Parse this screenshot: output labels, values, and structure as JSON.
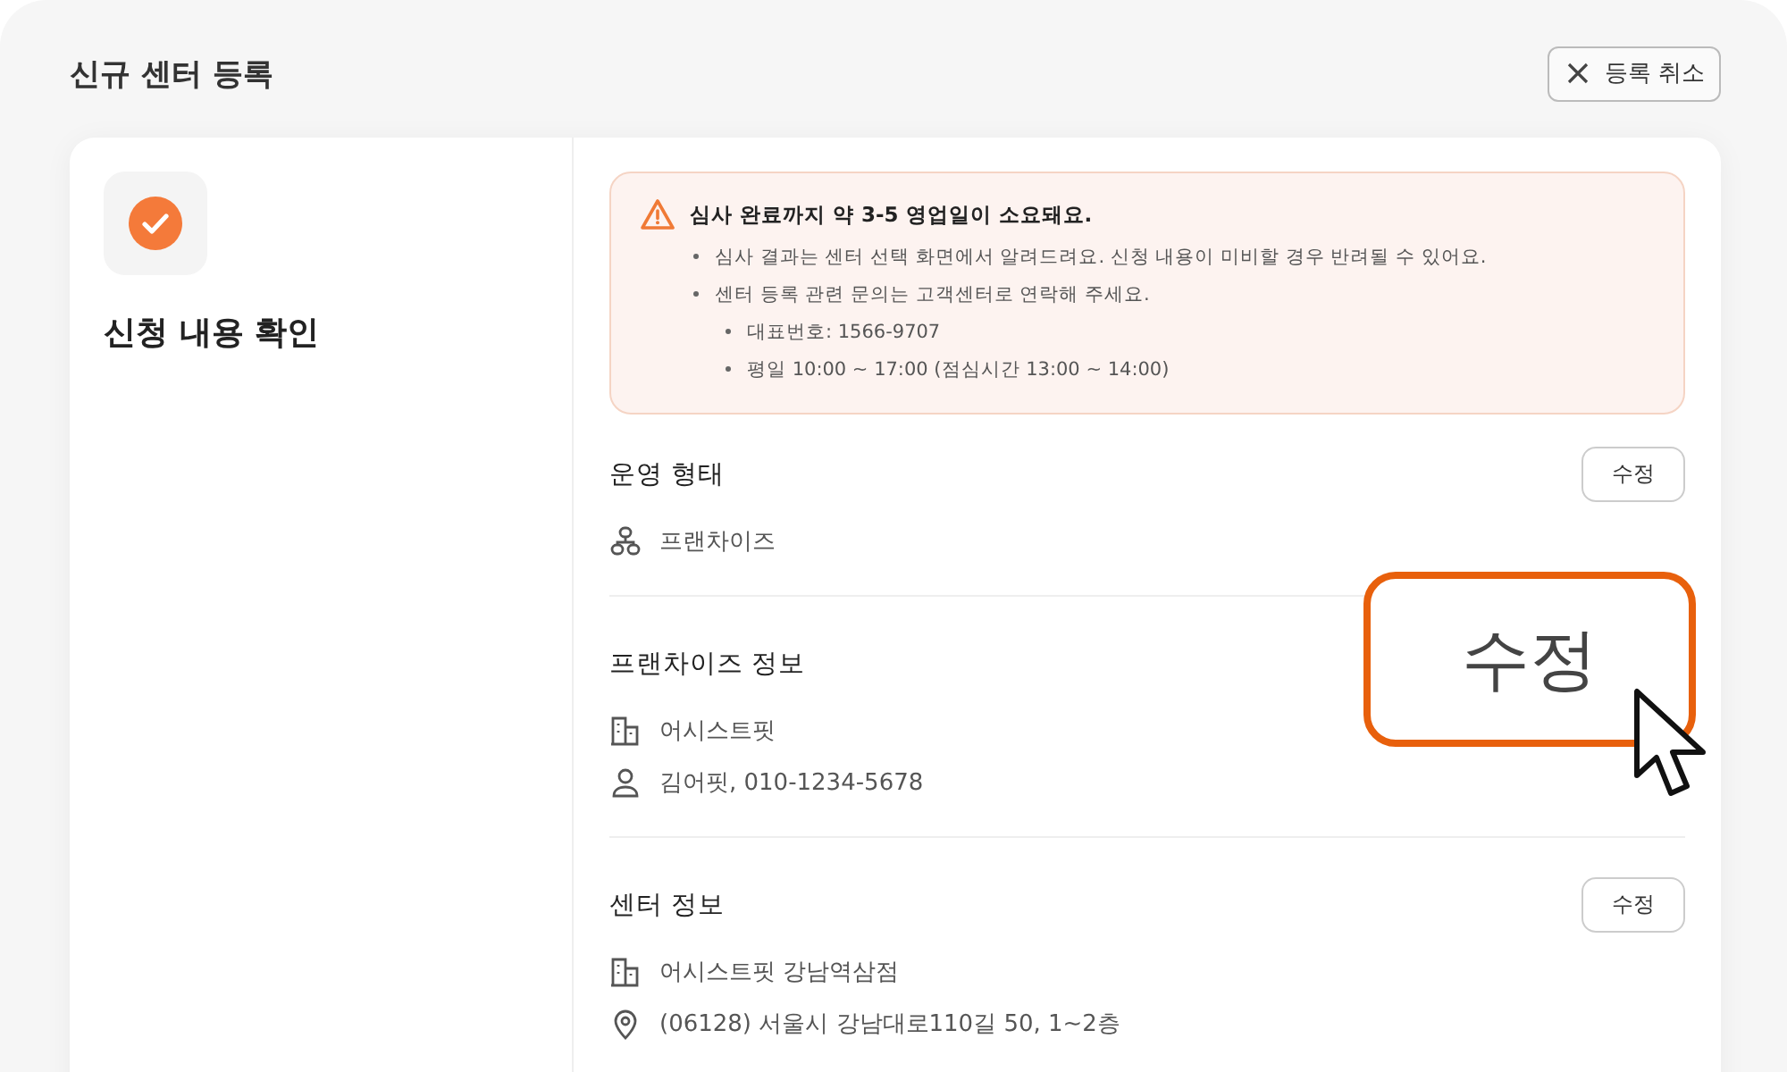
{
  "header": {
    "title": "신규 센터 등록",
    "cancel_button": "등록 취소"
  },
  "step": {
    "title": "신청 내용 확인",
    "done": true
  },
  "notice": {
    "title": "심사 완료까지 약 3-5 영업일이 소요돼요.",
    "items": [
      {
        "text": "심사 결과는 센터 선택 화면에서 알려드려요. 신청 내용이 미비할 경우 반려될 수 있어요."
      },
      {
        "text": "센터 등록 관련 문의는 고객센터로 연락해 주세요.",
        "children": [
          {
            "text": "대표번호: 1566-9707"
          },
          {
            "text": "평일 10:00 ~ 17:00 (점심시간 13:00 ~ 14:00)"
          }
        ]
      }
    ]
  },
  "sections": [
    {
      "title": "운영 형태",
      "edit_button": "수정",
      "highlighted": false,
      "items": [
        {
          "kind": "org",
          "text": "프랜차이즈"
        }
      ]
    },
    {
      "title": "프랜차이즈 정보",
      "edit_button": "수정",
      "highlighted": true,
      "items": [
        {
          "kind": "building",
          "text": "어시스트핏"
        },
        {
          "kind": "person",
          "text": "김어핏, 010-1234-5678"
        }
      ]
    },
    {
      "title": "센터 정보",
      "edit_button": "수정",
      "highlighted": false,
      "items": [
        {
          "kind": "building",
          "text": "어시스트핏 강남역삼점"
        },
        {
          "kind": "pin",
          "text": "(06128) 서울시 강남대로110길 50, 1~2층"
        }
      ]
    }
  ]
}
